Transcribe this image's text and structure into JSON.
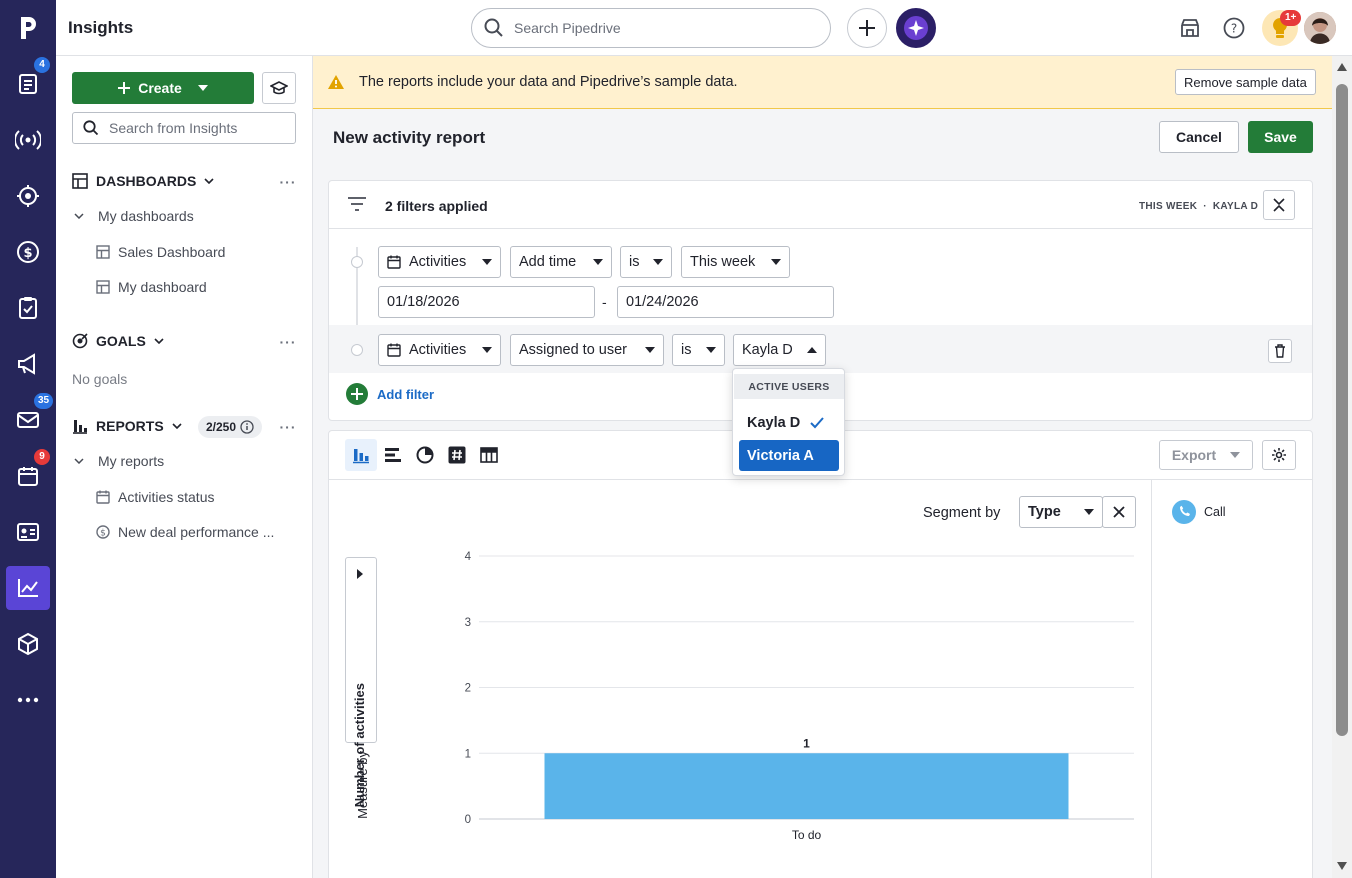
{
  "app": {
    "title": "Insights"
  },
  "rail": {
    "badges": {
      "leads": "4",
      "mail": "35",
      "activities": "9"
    }
  },
  "topbar": {
    "search_placeholder": "Search Pipedrive",
    "notification_badge": "1+"
  },
  "sidebar": {
    "create_label": "Create",
    "search_placeholder": "Search from Insights",
    "dashboards_heading": "DASHBOARDS",
    "my_dashboards": "My dashboards",
    "dashboards": [
      "Sales Dashboard",
      "My dashboard"
    ],
    "goals_heading": "GOALS",
    "no_goals": "No goals",
    "reports_heading": "REPORTS",
    "reports_count": "2/250",
    "my_reports": "My reports",
    "reports": [
      "Activities status",
      "New deal performance ..."
    ]
  },
  "banner": {
    "text": "The reports include your data and Pipedrive’s sample data.",
    "remove_label": "Remove sample data"
  },
  "report": {
    "title": "New activity report",
    "cancel_label": "Cancel",
    "save_label": "Save"
  },
  "filters": {
    "count_label": "2 filters applied",
    "summary": [
      "THIS WEEK",
      "·",
      "KAYLA D"
    ],
    "row1": {
      "entity": "Activities",
      "field": "Add time",
      "operator": "is",
      "value": "This week",
      "date_from": "01/18/2026",
      "date_sep": "-",
      "date_to": "01/24/2026"
    },
    "row2": {
      "entity": "Activities",
      "field": "Assigned to user",
      "operator": "is",
      "value": "Kayla D"
    },
    "add_filter_label": "Add filter"
  },
  "user_menu": {
    "header": "ACTIVE USERS",
    "options": [
      {
        "label": "Kayla D",
        "selected": true
      },
      {
        "label": "Victoria A",
        "highlighted": true
      }
    ]
  },
  "chart_toolbar": {
    "export_label": "Export"
  },
  "segment": {
    "label": "Segment by",
    "value": "Type"
  },
  "measure": {
    "prefix": "Measure by",
    "value": "Number of activities"
  },
  "legend": {
    "items": [
      {
        "label": "Call",
        "color": "#5ab4ea"
      }
    ]
  },
  "chart_data": {
    "type": "bar",
    "categories": [
      "To do"
    ],
    "series": [
      {
        "name": "Call",
        "values": [
          1
        ],
        "color": "#5ab4ea"
      }
    ],
    "data_labels": [
      "1"
    ],
    "ylim": [
      0,
      4
    ],
    "yticks": [
      "0",
      "1",
      "2",
      "3",
      "4"
    ],
    "grid": true
  }
}
